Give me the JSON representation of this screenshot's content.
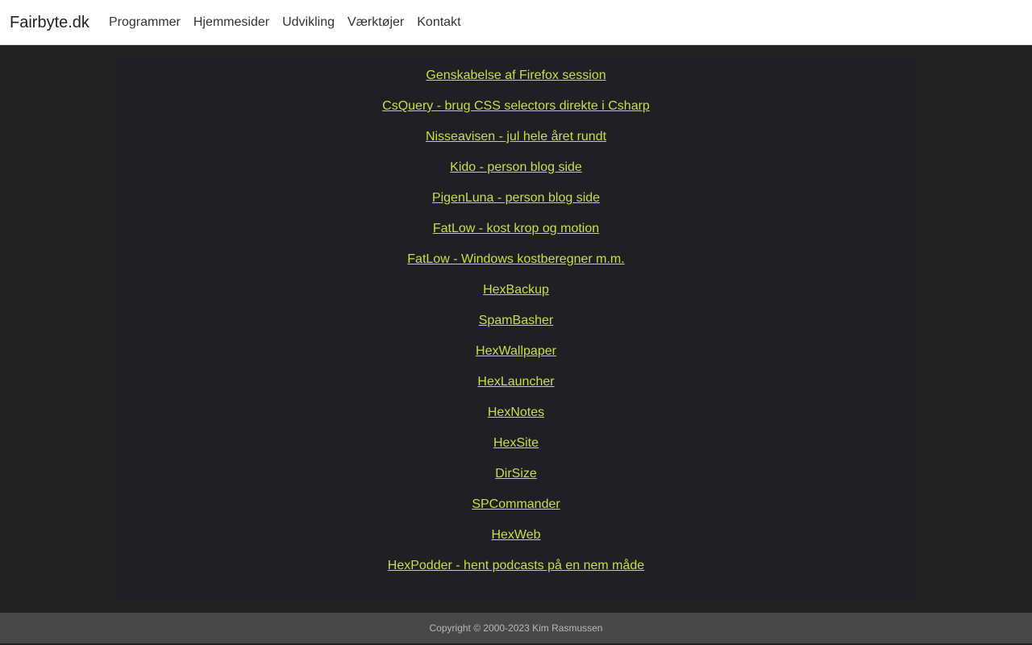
{
  "navbar": {
    "brand": "Fairbyte.dk",
    "links": [
      "Programmer",
      "Hjemmesider",
      "Udvikling",
      "Værktøjer",
      "Kontakt"
    ]
  },
  "main": {
    "links": [
      "Genskabelse af Firefox session",
      "CsQuery - brug CSS selectors direkte i Csharp",
      "Nisseavisen - jul hele året rundt",
      "Kido - person blog side",
      "PigenLuna - person blog side",
      "FatLow - kost krop og motion",
      "FatLow - Windows kostberegner m.m.",
      "HexBackup",
      "SpamBasher",
      "HexWallpaper",
      "HexLauncher",
      "HexNotes",
      "HexSite",
      "DirSize",
      "SPCommander",
      "HexWeb",
      "HexPodder - hent podcasts på en nem måde"
    ]
  },
  "footer": {
    "copyright": "Copyright © 2000-2023 Kim Rasmussen"
  },
  "colors": {
    "link": "#c8df3f",
    "background": "#222222",
    "panel": "#1f2023",
    "footer": "#484848"
  }
}
